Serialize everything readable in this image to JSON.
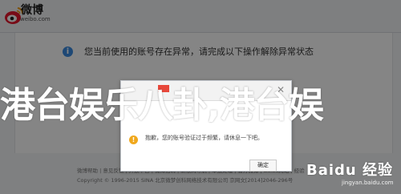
{
  "header": {
    "logo_text": "微博",
    "logo_sub": "weibo.com"
  },
  "main": {
    "notice_text": "您当前使用的账号存在异常，请完成以下操作解除异常状态"
  },
  "dialog": {
    "message": "抱歉，您的账号验证过于频繁，请休息一下吧。",
    "ok_label": "确定"
  },
  "banner": {
    "text": "港台娱乐八卦,港台娱"
  },
  "footer": {
    "links": "微博帮助 | 意见反馈 | 开放平台 | 微博招聘 | 新浪网导航 | 举报处理 | 官方微博 | Baidu网站 | 经验",
    "copyright": "Copyright © 1996-2015 SINA 北京微梦创科网络技术有限公司 京网文[2014]2046-296号"
  },
  "watermark": {
    "main": "Baidu 经验",
    "sub": "jingyan.baidu.com"
  },
  "colors": {
    "overlay": "#000000",
    "info_blue": "#3b8be0",
    "warning_orange": "#f0a81d",
    "flag_red": "#e8483b"
  }
}
